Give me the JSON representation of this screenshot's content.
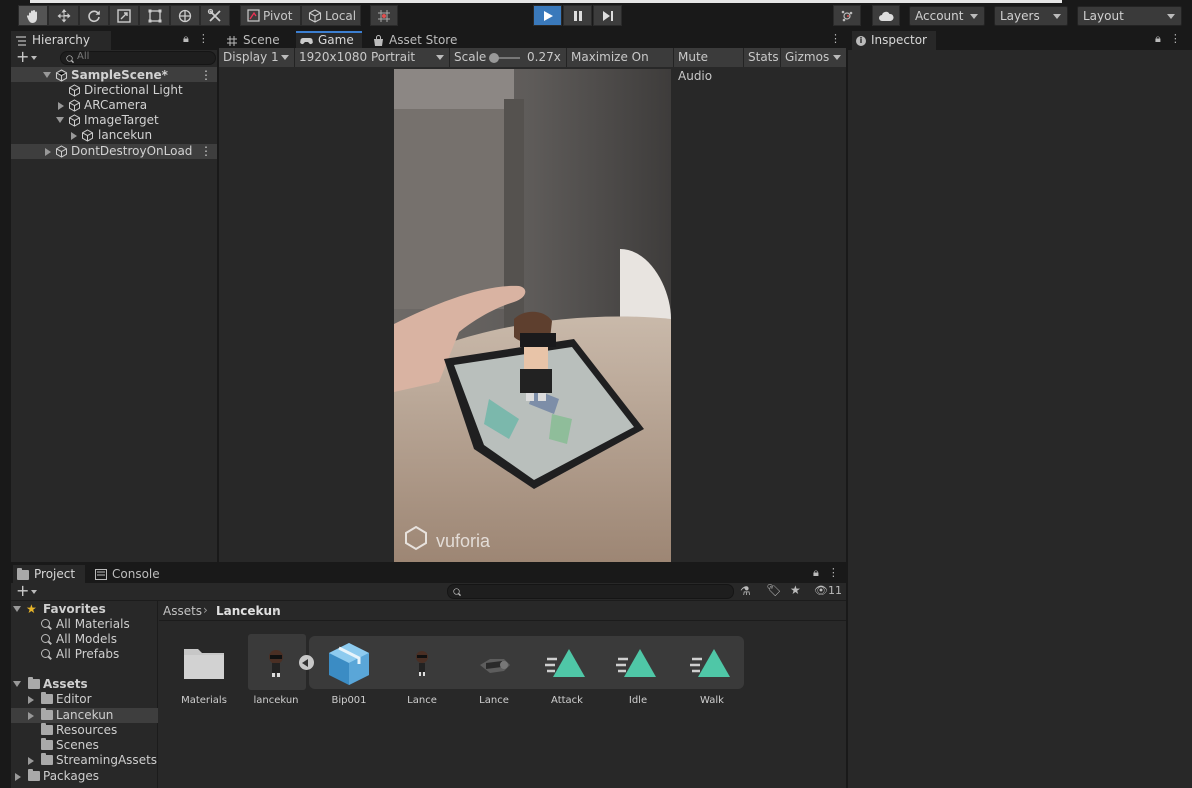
{
  "toolbar": {
    "pivot": "Pivot",
    "local": "Local",
    "account": "Account",
    "layers": "Layers",
    "layout": "Layout",
    "play_accent": "#3a79bb"
  },
  "hierarchy": {
    "tab": "Hierarchy",
    "search_placeholder": "All",
    "items": [
      {
        "label": "SampleScene*",
        "icon": "unity-scene-icon"
      },
      {
        "label": "Directional Light",
        "icon": "gameobject-cube-icon"
      },
      {
        "label": "ARCamera",
        "icon": "gameobject-cube-icon"
      },
      {
        "label": "ImageTarget",
        "icon": "gameobject-cube-icon"
      },
      {
        "label": "lancekun",
        "icon": "gameobject-cube-icon"
      },
      {
        "label": "DontDestroyOnLoad",
        "icon": "unity-scene-icon"
      }
    ]
  },
  "center": {
    "tabs": [
      "Scene",
      "Game",
      "Asset Store"
    ],
    "display": "Display 1",
    "resolution": "1920x1080 Portrait",
    "scale_label": "Scale",
    "scale_value": "0.27x",
    "maximize": "Maximize On Play",
    "mute": "Mute Audio",
    "stats": "Stats",
    "gizmos": "Gizmos",
    "watermark": "vuforia"
  },
  "inspector": {
    "tab": "Inspector"
  },
  "project": {
    "tabs": [
      "Project",
      "Console"
    ],
    "hidden_count": "11",
    "favorites_label": "Favorites",
    "favorites": [
      "All Materials",
      "All Models",
      "All Prefabs"
    ],
    "assets_label": "Assets",
    "asset_folders": [
      "Editor",
      "Lancekun",
      "Resources",
      "Scenes",
      "StreamingAssets"
    ],
    "packages_label": "Packages",
    "breadcrumb": [
      "Assets",
      "Lancekun"
    ],
    "items": [
      {
        "label": "Materials",
        "icon": "folder-icon"
      },
      {
        "label": "lancekun",
        "icon": "character-prefab-icon"
      },
      {
        "label": "Bip001",
        "icon": "model-cube-icon"
      },
      {
        "label": "Lance",
        "icon": "character-mesh-icon"
      },
      {
        "label": "Lance",
        "icon": "avatar-mesh-icon"
      },
      {
        "label": "Attack",
        "icon": "animation-clip-icon"
      },
      {
        "label": "Idle",
        "icon": "animation-clip-icon"
      },
      {
        "label": "Walk",
        "icon": "animation-clip-icon"
      }
    ]
  }
}
